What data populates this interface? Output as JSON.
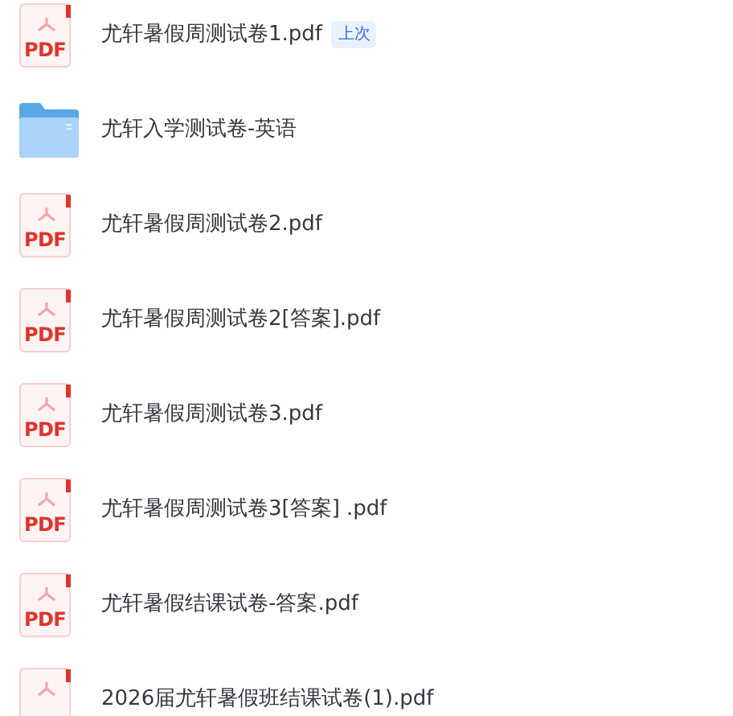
{
  "files": [
    {
      "kind": "pdf",
      "icon_label": "PDF",
      "name": "尤轩暑假周测试卷1.pdf",
      "badge": "上次"
    },
    {
      "kind": "folder",
      "name": "尤轩入学测试卷-英语"
    },
    {
      "kind": "pdf",
      "icon_label": "PDF",
      "name": "尤轩暑假周测试卷2.pdf"
    },
    {
      "kind": "pdf",
      "icon_label": "PDF",
      "name": "尤轩暑假周测试卷2[答案].pdf"
    },
    {
      "kind": "pdf",
      "icon_label": "PDF",
      "name": "尤轩暑假周测试卷3.pdf"
    },
    {
      "kind": "pdf",
      "icon_label": "PDF",
      "name": "尤轩暑假周测试卷3[答案] .pdf"
    },
    {
      "kind": "pdf",
      "icon_label": "PDF",
      "name": "尤轩暑假结课试卷-答案.pdf"
    },
    {
      "kind": "pdf",
      "name": "2026届尤轩暑假班结课试卷(1).pdf"
    }
  ]
}
